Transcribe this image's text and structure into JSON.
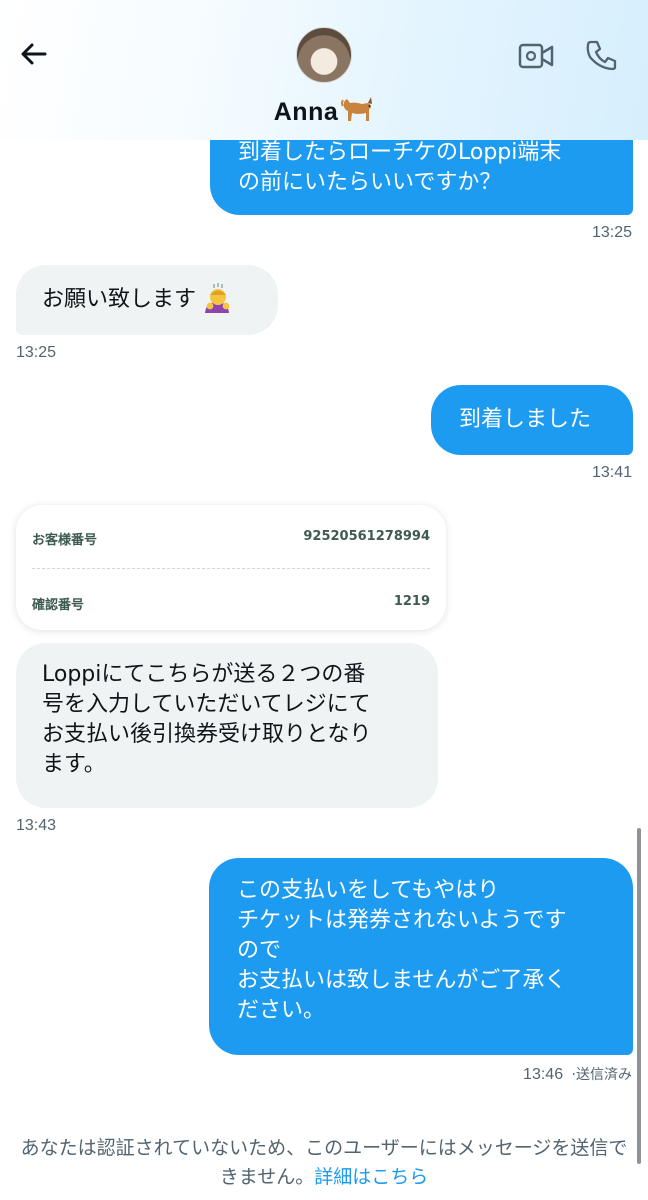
{
  "header": {
    "contact_name": "Anna",
    "name_emoji": "dog-emoji",
    "back_icon": "arrow-left-icon",
    "video_icon": "video-camera-icon",
    "call_icon": "phone-icon"
  },
  "messages": [
    {
      "text": "到着したらローチケのLoppi端末\nの前にいたらいいですか？",
      "time": "13:25",
      "sender": "me"
    },
    {
      "text": "お願い致します",
      "emoji": "person-bowing-emoji",
      "time": "13:25",
      "sender": "them"
    },
    {
      "text": "到着しました",
      "time": "13:41",
      "sender": "me"
    },
    {
      "text": "Loppiにてこちらが送る２つの番\n号を入力していただいてレジにて\nお支払い後引換券受け取りとなり\nます。",
      "time": "13:43",
      "sender": "them"
    },
    {
      "text": "この支払いをしてもやはり\nチケットは発券されないようです\nので\nお支払いは致しませんがご了承く\nださい。",
      "time": "13:46",
      "status": "·送信済み",
      "sender": "me"
    }
  ],
  "card": {
    "rows": [
      {
        "label": "お客様番号",
        "value": "92520561278994"
      },
      {
        "label": "確認番号",
        "value": "1219"
      }
    ]
  },
  "notice": {
    "text": "あなたは認証されていないため、このユーザーにはメッセージを送信できません。",
    "link": "詳細はこちら"
  },
  "colors": {
    "accent": "#1d9bf0",
    "incoming_bubble": "#eff3f4",
    "muted_text": "#536471"
  }
}
